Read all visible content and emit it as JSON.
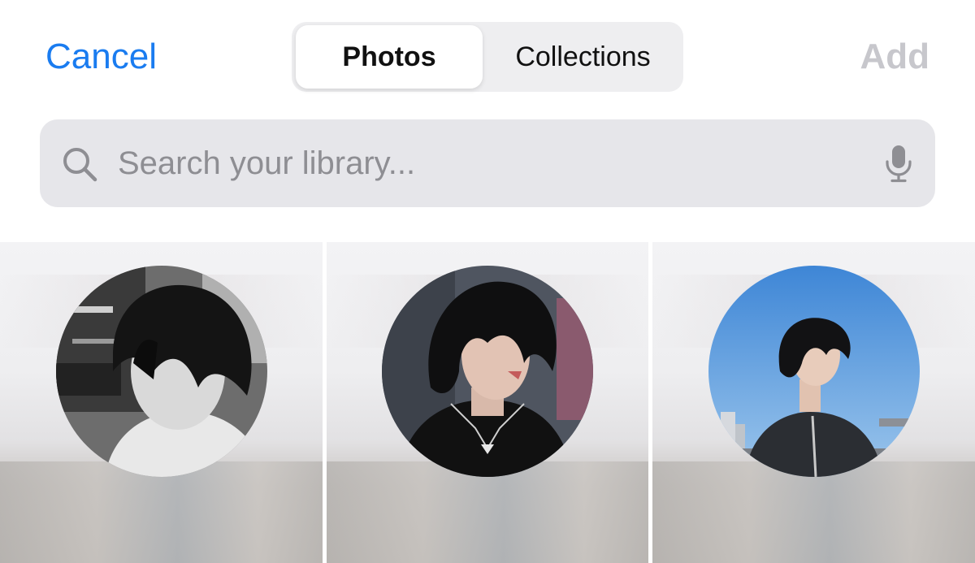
{
  "header": {
    "cancel_label": "Cancel",
    "add_label": "Add",
    "tabs": [
      {
        "label": "Photos",
        "selected": true
      },
      {
        "label": "Collections",
        "selected": false
      }
    ]
  },
  "search": {
    "placeholder": "Search your library...",
    "value": ""
  },
  "icons": {
    "search": "magnifying-glass",
    "mic": "microphone"
  },
  "photos": [
    {
      "type": "profile-photo",
      "style": "black-and-white"
    },
    {
      "type": "profile-photo",
      "style": "dark-portrait"
    },
    {
      "type": "profile-photo",
      "style": "blue-sky"
    }
  ],
  "colors": {
    "accent": "#1a7cf0",
    "disabled": "#c7c7cc",
    "search_bg": "#e6e6ea",
    "segment_bg": "#eeeef0"
  }
}
